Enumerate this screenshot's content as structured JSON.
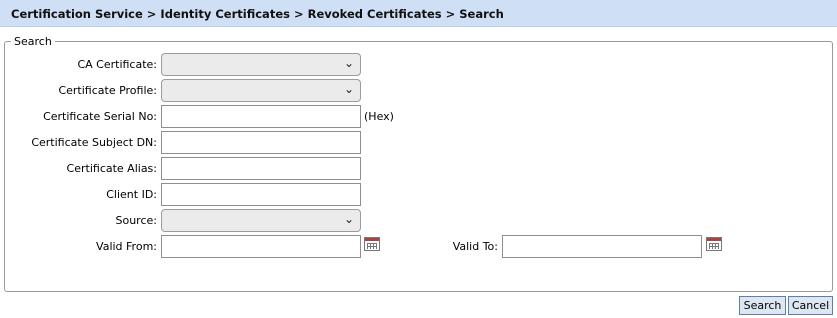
{
  "breadcrumb": "Certification Service > Identity Certificates > Revoked Certificates > Search",
  "search": {
    "legend": "Search",
    "fields": {
      "ca_certificate": {
        "label": "CA Certificate:",
        "value": ""
      },
      "certificate_profile": {
        "label": "Certificate Profile:",
        "value": ""
      },
      "serial_no": {
        "label": "Certificate Serial No:",
        "value": "",
        "suffix": "(Hex)"
      },
      "subject_dn": {
        "label": "Certificate Subject DN:",
        "value": ""
      },
      "alias": {
        "label": "Certificate Alias:",
        "value": ""
      },
      "client_id": {
        "label": "Client ID:",
        "value": ""
      },
      "source": {
        "label": "Source:",
        "value": ""
      },
      "valid_from": {
        "label": "Valid From:",
        "value": ""
      },
      "valid_to": {
        "label": "Valid To:",
        "value": ""
      }
    }
  },
  "buttons": {
    "search": "Search",
    "cancel": "Cancel"
  },
  "colors": {
    "header_bg": "#cfe0f6",
    "button_bg": "#dde7f4",
    "button_border": "#5f7fa8"
  },
  "icons": {
    "dropdown": "chevron-down-icon",
    "calendar": "calendar-icon"
  }
}
